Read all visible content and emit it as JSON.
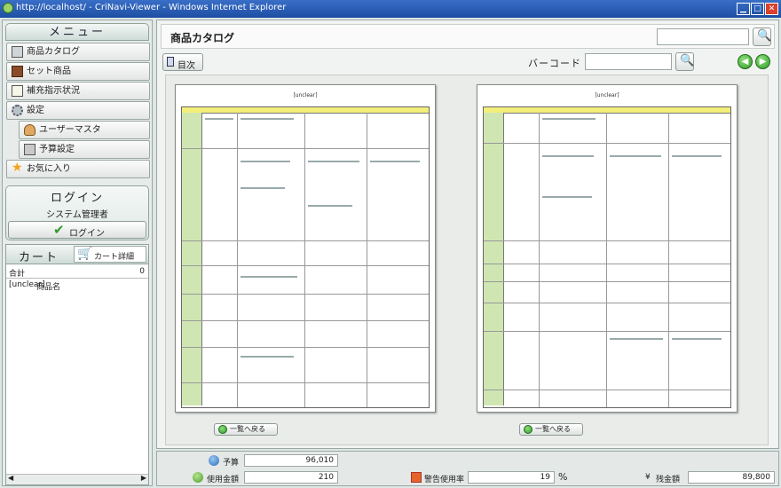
{
  "window": {
    "title": "http://localhost/ - CriNavi-Viewer - Windows Internet Explorer"
  },
  "sidebar": {
    "menu_title": "メニュー",
    "items": [
      {
        "label": "商品カタログ",
        "icon": "book-icon"
      },
      {
        "label": "セット商品",
        "icon": "box-icon"
      },
      {
        "label": "補充指示状況",
        "icon": "clipboard-icon"
      },
      {
        "label": "設定",
        "icon": "gear-icon"
      },
      {
        "label": "ユーザーマスタ",
        "icon": "user-icon"
      },
      {
        "label": "予算設定",
        "icon": "calculator-icon"
      },
      {
        "label": "お気に入り",
        "icon": "star-icon"
      }
    ],
    "login": {
      "title": "ログイン",
      "user": "システム管理者",
      "button": "ログイン"
    },
    "cart": {
      "title": "カート",
      "detail_button": "カート詳細",
      "total_label": "合計",
      "total_value": "0",
      "col_qty": "[unclear]",
      "col_name": "商品名"
    }
  },
  "main": {
    "title": "商品カタログ",
    "toc_button": "目次",
    "barcode_label": "バーコード",
    "search_value": "",
    "barcode_value": "",
    "pages": [
      {
        "title": "[unclear]"
      },
      {
        "title": "[unclear]"
      }
    ],
    "back_button": "一覧へ戻る"
  },
  "footer": {
    "budget_label": "予算",
    "budget_value": "96,010",
    "used_label": "使用金額",
    "used_value": "210",
    "warn_label": "警告使用率",
    "warn_value": "19",
    "warn_unit": "%",
    "remain_label": "残金額",
    "remain_prefix": "¥",
    "remain_value": "89,800"
  },
  "colors": {
    "accent": "#2f9a2a",
    "titlebar": "#1d4ea3",
    "doc_header": "#f3ef7a",
    "doc_side": "#cfe6b2"
  }
}
